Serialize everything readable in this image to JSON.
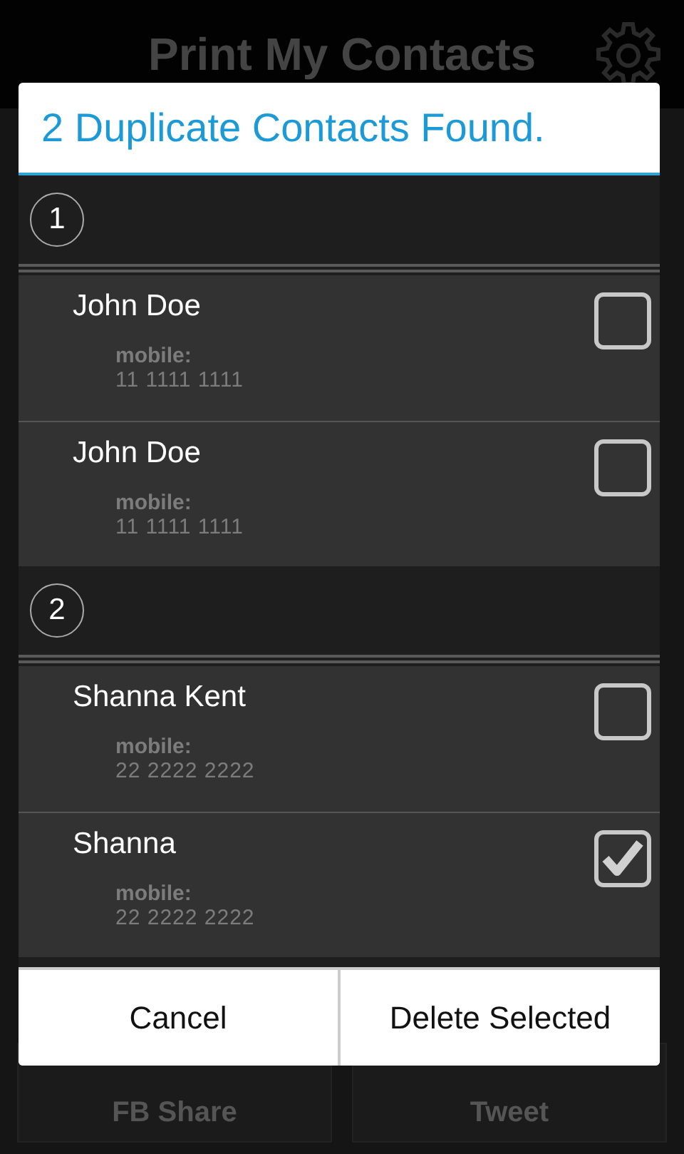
{
  "app": {
    "title": "Print My Contacts",
    "actions": [
      "FB Share",
      "Tweet"
    ]
  },
  "dialog": {
    "title": "2 Duplicate Contacts Found.",
    "groups": [
      {
        "number": "1",
        "contacts": [
          {
            "name": "John Doe",
            "label": "mobile:",
            "phone": "11 1111 1111",
            "checked": false
          },
          {
            "name": "John Doe",
            "label": "mobile:",
            "phone": "11 1111 1111",
            "checked": false
          }
        ]
      },
      {
        "number": "2",
        "contacts": [
          {
            "name": "Shanna Kent",
            "label": "mobile:",
            "phone": "22 2222 2222",
            "checked": false
          },
          {
            "name": "Shanna",
            "label": "mobile:",
            "phone": "22 2222 2222",
            "checked": true
          }
        ]
      }
    ],
    "buttons": [
      "Cancel",
      "Delete Selected"
    ]
  }
}
